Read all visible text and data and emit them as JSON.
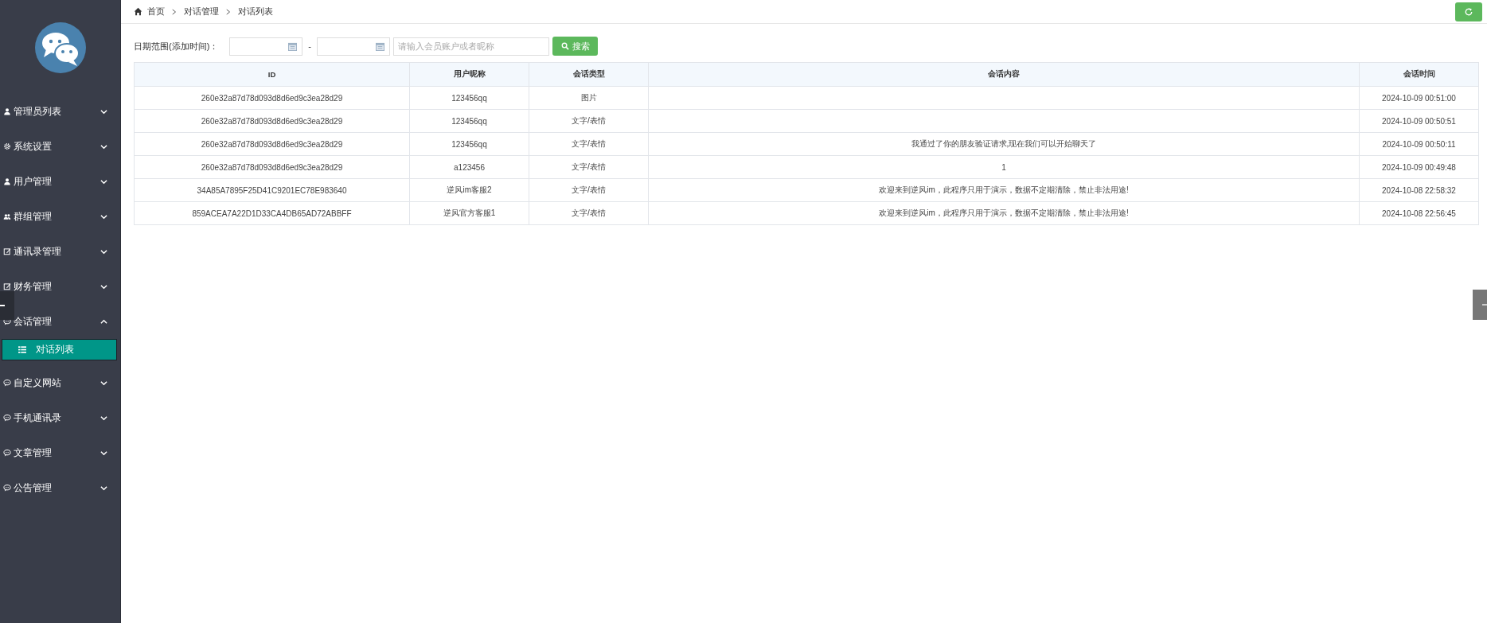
{
  "sidebar": {
    "items": [
      {
        "label": "管理员列表",
        "kind": "user",
        "expanded": false
      },
      {
        "label": "系统设置",
        "kind": "gear",
        "expanded": false
      },
      {
        "label": "用户管理",
        "kind": "user",
        "expanded": false
      },
      {
        "label": "群组管理",
        "kind": "group",
        "expanded": false
      },
      {
        "label": "通讯录管理",
        "kind": "edit",
        "expanded": false
      },
      {
        "label": "财务管理",
        "kind": "edit",
        "expanded": false
      },
      {
        "label": "会话管理",
        "kind": "chat",
        "expanded": true,
        "children": [
          {
            "label": "对话列表",
            "selected": true
          }
        ]
      },
      {
        "label": "自定义网站",
        "kind": "chat",
        "expanded": false
      },
      {
        "label": "手机通讯录",
        "kind": "chat",
        "expanded": false
      },
      {
        "label": "文章管理",
        "kind": "chat",
        "expanded": false
      },
      {
        "label": "公告管理",
        "kind": "chat",
        "expanded": false
      }
    ]
  },
  "breadcrumb": [
    "首页",
    "对话管理",
    "对话列表"
  ],
  "filter": {
    "label": "日期范围(添加时间)：",
    "separator": "-",
    "search_placeholder": "请输入会员账户或者昵称",
    "search_button": "搜索"
  },
  "table": {
    "columns": [
      "ID",
      "用户昵称",
      "会话类型",
      "会话内容",
      "会话时间"
    ],
    "rows": [
      {
        "id": "260e32a87d78d093d8d6ed9c3ea28d29",
        "nickname": "123456qq",
        "type": "图片",
        "time": "2024-10-09 00:51:00"
      },
      {
        "id": "260e32a87d78d093d8d6ed9c3ea28d29",
        "nickname": "123456qq",
        "type": "文字/表情",
        "time": "2024-10-09 00:50:51"
      },
      {
        "id": "260e32a87d78d093d8d6ed9c3ea28d29",
        "nickname": "123456qq",
        "type": "文字/表情",
        "content": "我通过了你的朋友验证请求,现在我们可以开始聊天了",
        "time": "2024-10-09 00:50:11"
      },
      {
        "id": "260e32a87d78d093d8d6ed9c3ea28d29",
        "nickname": "a123456",
        "type": "文字/表情",
        "content": "1",
        "time": "2024-10-09 00:49:48"
      },
      {
        "id": "34A85A7895F25D41C9201EC78E983640",
        "nickname": "逆风im客服2",
        "type": "文字/表情",
        "content": "欢迎来到逆风im，此程序只用于演示，数据不定期清除，禁止非法用途!",
        "time": "2024-10-08 22:58:32"
      },
      {
        "id": "859ACEA7A22D1D33CA4DB65AD72ABBFF",
        "nickname": "逆风官方客服1",
        "type": "文字/表情",
        "content": "欢迎来到逆风im，此程序只用于演示，数据不定期清除，禁止非法用途!",
        "time": "2024-10-08 22:56:45"
      }
    ]
  }
}
